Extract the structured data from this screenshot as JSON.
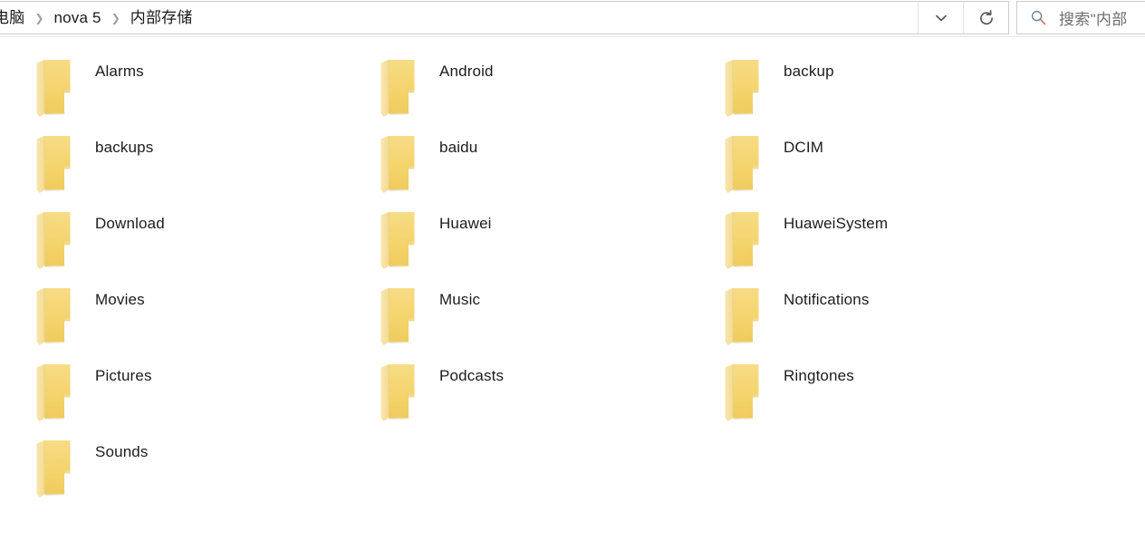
{
  "window": {
    "type": "file-explorer",
    "background": "#ffffff"
  },
  "address_bar": {
    "breadcrumb": [
      {
        "label": "电脑",
        "clipped": true
      },
      {
        "label": "nova 5",
        "clipped": false
      },
      {
        "label": "内部存储",
        "clipped": false
      }
    ],
    "separator": "❯",
    "dropdown_icon": "chevron-down-icon",
    "refresh_icon": "refresh-icon"
  },
  "search": {
    "icon": "search-icon",
    "placeholder": "搜索\"内部",
    "value": ""
  },
  "colors": {
    "folder_front": "#f5d66e",
    "folder_flap": "#f7e3a4",
    "folder_edge": "#ead07a",
    "text": "#1c1c1c",
    "placeholder_text": "#6e6e6e",
    "border": "#cccccc",
    "separator": "#e4e4e4"
  },
  "files": {
    "view": "medium-icons",
    "columns": 3,
    "items": [
      {
        "name": "Alarms",
        "type": "folder",
        "icon": "folder-icon"
      },
      {
        "name": "Android",
        "type": "folder",
        "icon": "folder-icon"
      },
      {
        "name": "backup",
        "type": "folder",
        "icon": "folder-icon"
      },
      {
        "name": "backups",
        "type": "folder",
        "icon": "folder-icon"
      },
      {
        "name": "baidu",
        "type": "folder",
        "icon": "folder-icon"
      },
      {
        "name": "DCIM",
        "type": "folder",
        "icon": "folder-icon"
      },
      {
        "name": "Download",
        "type": "folder",
        "icon": "folder-icon"
      },
      {
        "name": "Huawei",
        "type": "folder",
        "icon": "folder-icon"
      },
      {
        "name": "HuaweiSystem",
        "type": "folder",
        "icon": "folder-icon"
      },
      {
        "name": "Movies",
        "type": "folder",
        "icon": "folder-icon"
      },
      {
        "name": "Music",
        "type": "folder",
        "icon": "folder-icon"
      },
      {
        "name": "Notifications",
        "type": "folder",
        "icon": "folder-icon"
      },
      {
        "name": "Pictures",
        "type": "folder",
        "icon": "folder-icon"
      },
      {
        "name": "Podcasts",
        "type": "folder",
        "icon": "folder-icon"
      },
      {
        "name": "Ringtones",
        "type": "folder",
        "icon": "folder-icon"
      },
      {
        "name": "Sounds",
        "type": "folder",
        "icon": "folder-icon"
      }
    ]
  }
}
